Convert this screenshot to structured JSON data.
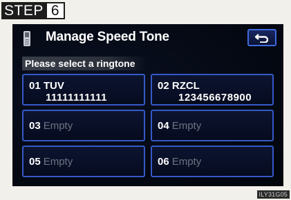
{
  "step": {
    "label": "STEP",
    "number": "6"
  },
  "header": {
    "title": "Manage Speed Tone"
  },
  "subtitle": "Please select a ringtone",
  "tiles": [
    {
      "num": "01",
      "name": "TUV",
      "value": "11111111111"
    },
    {
      "num": "02",
      "name": "RZCL",
      "value": "123456678900"
    },
    {
      "num": "03",
      "name": "Empty"
    },
    {
      "num": "04",
      "name": "Empty"
    },
    {
      "num": "05",
      "name": "Empty"
    },
    {
      "num": "06",
      "name": "Empty"
    }
  ],
  "figure_code": "ILY31G05",
  "colors": {
    "accent": "#3559c8",
    "background": "#050913",
    "text": "#ffffff",
    "empty_text": "#6e7382"
  },
  "icons": {
    "header": "phone-icon",
    "back": "return-arrow-icon"
  }
}
